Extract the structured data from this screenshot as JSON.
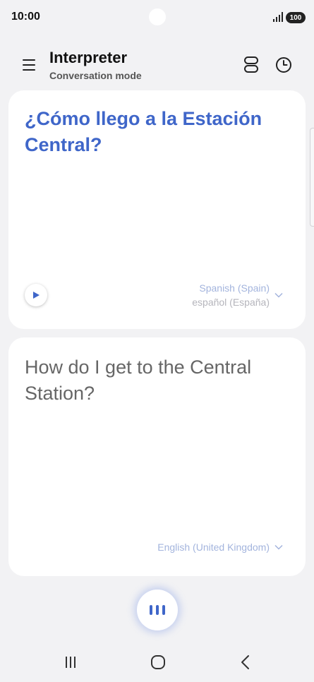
{
  "status_bar": {
    "time": "10:00",
    "battery": "100"
  },
  "header": {
    "title": "Interpreter",
    "subtitle": "Conversation mode"
  },
  "source_card": {
    "text": "¿Cómo llego a la Estación Central?",
    "language_primary": "Spanish (Spain)",
    "language_secondary": "español (España)"
  },
  "target_card": {
    "text": "How do I get to the Central Station?",
    "language_primary": "English (United Kingdom)"
  },
  "icons": {
    "menu": "menu-icon",
    "view": "split-view-icon",
    "history": "clock-icon",
    "play": "play-icon",
    "mic": "voice-bars-icon"
  },
  "colors": {
    "accent": "#3f66c9",
    "background": "#f2f2f4",
    "card": "#ffffff"
  }
}
